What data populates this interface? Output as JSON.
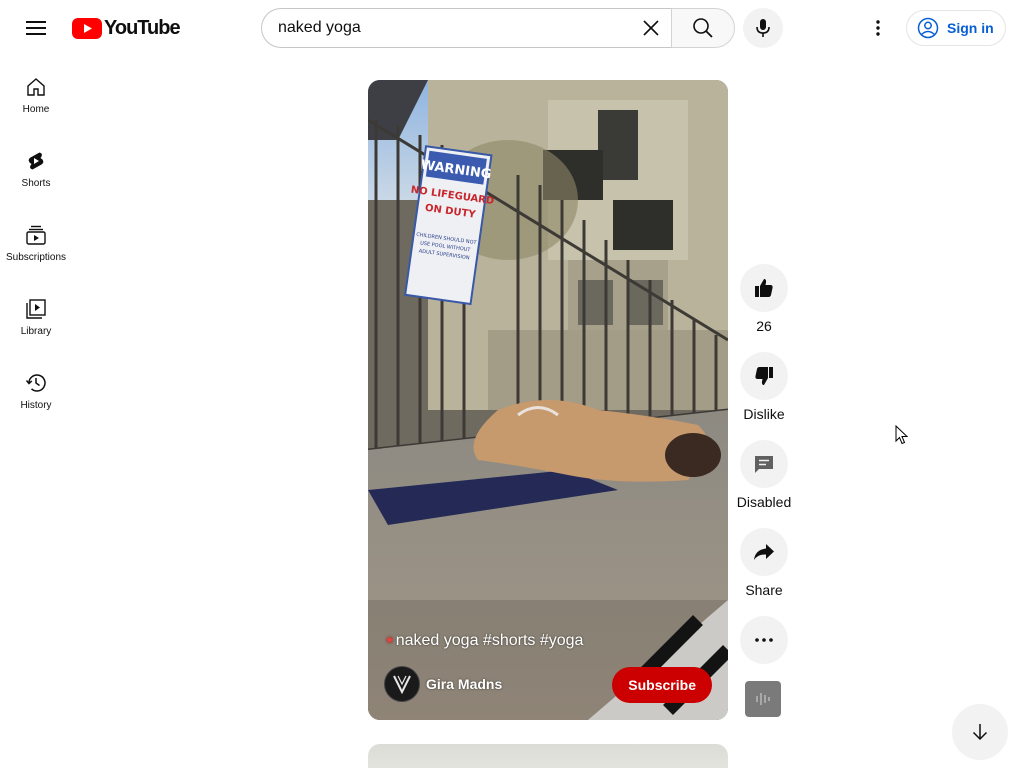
{
  "header": {
    "logo_text": "YouTube",
    "search": {
      "value": "naked yoga",
      "placeholder": "Search"
    },
    "signin_label": "Sign in"
  },
  "sidebar": {
    "items": [
      {
        "label": "Home",
        "icon": "home-icon"
      },
      {
        "label": "Shorts",
        "icon": "shorts-icon"
      },
      {
        "label": "Subscriptions",
        "icon": "subscriptions-icon"
      },
      {
        "label": "Library",
        "icon": "library-icon"
      },
      {
        "label": "History",
        "icon": "history-icon"
      }
    ]
  },
  "short": {
    "title": "naked yoga #shorts #yoga",
    "title_prefix_icon": "sparkle-emoji",
    "channel_name": "Gira Madns",
    "subscribe_label": "Subscribe",
    "sign_text": [
      "WARNING",
      "NO LIFEGUARD",
      "ON DUTY",
      "CHILDREN SHOULD NOT",
      "USE POOL WITHOUT",
      "ADULT SUPERVISION"
    ]
  },
  "actions": {
    "like_count": "26",
    "dislike_label": "Dislike",
    "comments_label": "Disabled",
    "share_label": "Share"
  },
  "colors": {
    "brand_red": "#ff0000",
    "subscribe_red": "#cc0000",
    "signin_blue": "#065fd4",
    "chip_grey": "#f2f2f2"
  }
}
